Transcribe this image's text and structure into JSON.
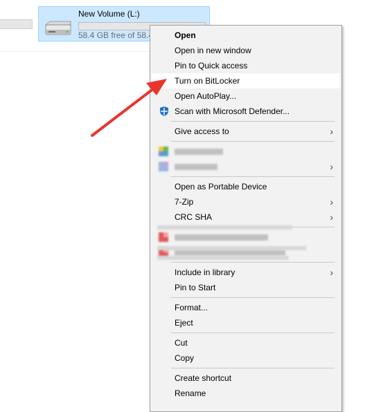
{
  "drive": {
    "name": "New Volume (L:)",
    "free_text": "58.4 GB free of 58.4 GB",
    "icon": "hard-drive-icon"
  },
  "context_menu": {
    "groups": [
      [
        {
          "label": "Open",
          "bold": true
        },
        {
          "label": "Open in new window"
        },
        {
          "label": "Pin to Quick access"
        },
        {
          "label": "Turn on BitLocker",
          "highlighted": true
        },
        {
          "label": "Open AutoPlay..."
        },
        {
          "label": "Scan with Microsoft Defender...",
          "icon": "microsoft-defender-icon"
        }
      ],
      [
        {
          "label": "Give access to",
          "submenu": true
        }
      ],
      [
        {
          "label": "",
          "blurred": true,
          "icon": "blurred-app-icon"
        },
        {
          "label": "",
          "blurred": true,
          "submenu": true,
          "icon": "blurred-app-icon"
        }
      ],
      [
        {
          "label": "Open as Portable Device"
        },
        {
          "label": "7-Zip",
          "submenu": true
        },
        {
          "label": "CRC SHA",
          "submenu": true
        }
      ],
      [
        {
          "label": "",
          "blurred": true,
          "icon": "blurred-app-icon"
        },
        {
          "label": "",
          "blurred": true,
          "icon": "blurred-app-icon"
        }
      ],
      [
        {
          "label": "Include in library",
          "submenu": true
        },
        {
          "label": "Pin to Start"
        }
      ],
      [
        {
          "label": "Format..."
        },
        {
          "label": "Eject"
        }
      ],
      [
        {
          "label": "Cut"
        },
        {
          "label": "Copy"
        }
      ],
      [
        {
          "label": "Create shortcut"
        },
        {
          "label": "Rename"
        }
      ]
    ]
  },
  "annotation": {
    "arrow_color": "#e8352e"
  },
  "colors": {
    "selection_fill": "#cce8ff",
    "selection_border": "#99d1ff",
    "menu_bg": "#f2f2f2",
    "menu_hover": "#ffffff",
    "defender_blue": "#1c73c4"
  }
}
